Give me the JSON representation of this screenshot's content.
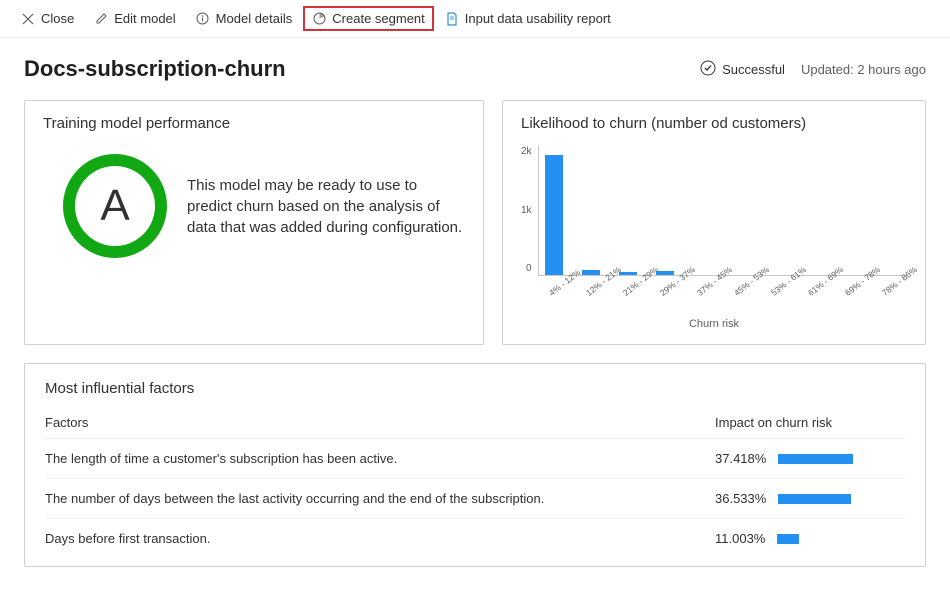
{
  "toolbar": {
    "close": "Close",
    "edit_model": "Edit model",
    "model_details": "Model details",
    "create_segment": "Create segment",
    "input_report": "Input data usability report"
  },
  "header": {
    "title": "Docs-subscription-churn",
    "status": "Successful",
    "updated": "Updated: 2 hours ago"
  },
  "performance": {
    "title": "Training model performance",
    "grade": "A",
    "description": "This model may be ready to use to predict churn based on the analysis of data that was added during configuration."
  },
  "chart_data": {
    "type": "bar",
    "title": "Likelihood to churn (number od customers)",
    "xlabel": "Churn risk",
    "ylabel": "",
    "y_ticks": [
      "2k",
      "1k",
      "0"
    ],
    "ylim": [
      0,
      2200
    ],
    "categories": [
      "4% - 12%",
      "12% - 21%",
      "21% - 29%",
      "29% - 37%",
      "37% - 45%",
      "45% - 53%",
      "53% - 61%",
      "61% - 69%",
      "69% - 78%",
      "78% - 86%"
    ],
    "values": [
      2050,
      80,
      50,
      60,
      0,
      0,
      0,
      0,
      0,
      0
    ]
  },
  "factors": {
    "title": "Most influential factors",
    "col_factor": "Factors",
    "col_impact": "Impact on churn risk",
    "rows": [
      {
        "label": "The length of time a customer's subscription has been active.",
        "impact_text": "37.418%",
        "impact_val": 37.418
      },
      {
        "label": "The number of days between the last activity occurring and the end of the subscription.",
        "impact_text": "36.533%",
        "impact_val": 36.533
      },
      {
        "label": "Days before first transaction.",
        "impact_text": "11.003%",
        "impact_val": 11.003
      }
    ]
  }
}
